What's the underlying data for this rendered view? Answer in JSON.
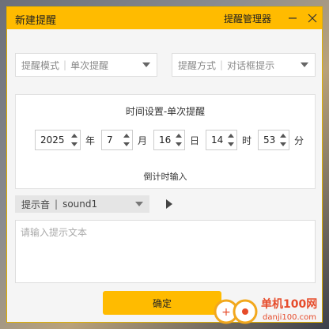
{
  "window": {
    "title": "新建提醒",
    "manager_link": "提醒管理器"
  },
  "reminder_mode": {
    "label": "提醒模式",
    "value": "单次提醒"
  },
  "reminder_method": {
    "label": "提醒方式",
    "value": "对话框提示"
  },
  "time_settings": {
    "title": "时间设置-单次提醒",
    "year": "2025",
    "year_unit": "年",
    "month": "7",
    "month_unit": "月",
    "day": "16",
    "day_unit": "日",
    "hour": "14",
    "hour_unit": "时",
    "minute": "53",
    "minute_unit": "分",
    "countdown_link": "倒计时输入"
  },
  "sound": {
    "label": "提示音",
    "value": "sound1"
  },
  "message": {
    "placeholder": "请输入提示文本"
  },
  "confirm_button": "确定",
  "watermark": {
    "text": "单机100网",
    "url": "danji100.com"
  },
  "colors": {
    "accent": "#ffbb00"
  }
}
